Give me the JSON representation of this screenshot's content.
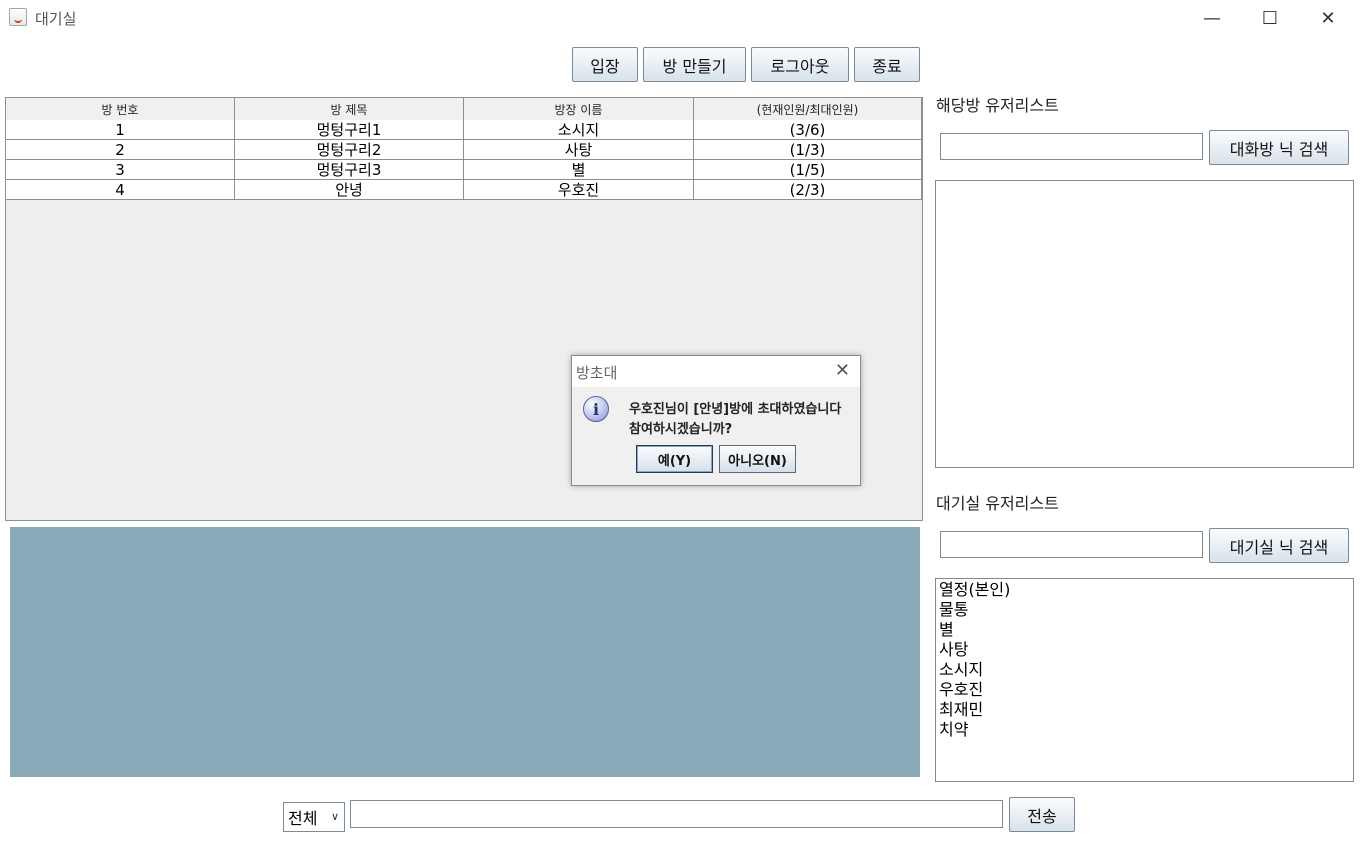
{
  "window": {
    "title": "대기실",
    "minimize": "—",
    "maximize": "☐",
    "close": "✕"
  },
  "toolbar": {
    "enter_label": "입장",
    "create_room_label": "방 만들기",
    "logout_label": "로그아웃",
    "exit_label": "종료"
  },
  "room_table": {
    "columns": [
      "방 번호",
      "방 제목",
      "방장 이름",
      "(현재인원/최대인원)"
    ],
    "rows": [
      [
        "1",
        "멍텅구리1",
        "소시지",
        "(3/6)"
      ],
      [
        "2",
        "멍텅구리2",
        "사탕",
        "(1/3)"
      ],
      [
        "3",
        "멍텅구리3",
        "별",
        "(1/5)"
      ],
      [
        "4",
        "안녕",
        "우호진",
        "(2/3)"
      ]
    ]
  },
  "room_users": {
    "label": "해당방 유저리스트",
    "search_value": "",
    "search_button": "대화방 닉 검색",
    "items": []
  },
  "lobby_users": {
    "label": "대기실 유저리스트",
    "search_value": "",
    "search_button": "대기실 닉 검색",
    "items": [
      "열정(본인)",
      "물통",
      "별",
      "사탕",
      "소시지",
      "우호진",
      "최재민",
      "치약"
    ]
  },
  "chat": {
    "scope_selected": "전체",
    "message_value": "",
    "send_label": "전송"
  },
  "dialog": {
    "title": "방초대",
    "close": "✕",
    "icon": "info-icon",
    "icon_glyph": "i",
    "message_line1": "우호진님이 [안녕]방에 초대하였습니다",
    "message_line2": "참여하시겠습니까?",
    "yes_label": "예(Y)",
    "no_label": "아니오(N)"
  },
  "colors": {
    "chat_area": "#89a8b8",
    "table_empty": "#eeeeee"
  }
}
